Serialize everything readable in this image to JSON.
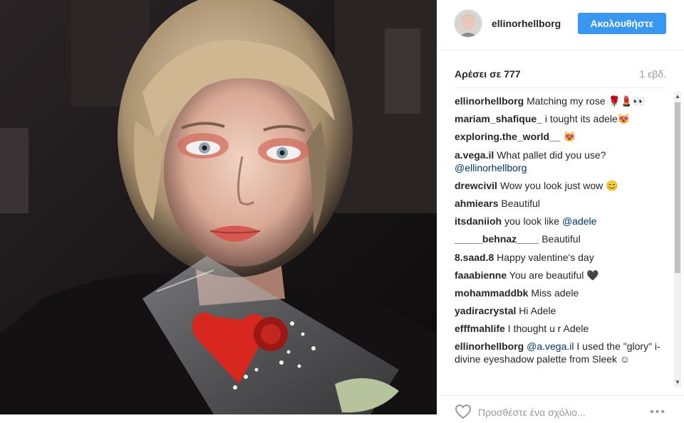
{
  "post": {
    "image_alt": "selfie with rose"
  },
  "header": {
    "username": "ellinorhellborg",
    "follow_label": "Ακολουθήστε"
  },
  "stats": {
    "likes_text": "Αρέσει σε 777",
    "time_ago": "1 εβδ."
  },
  "comments": [
    {
      "user": "ellinorhellborg",
      "parts": [
        {
          "t": "Matching my rose 🌹💄👀"
        }
      ]
    },
    {
      "user": "mariam_shafique_",
      "parts": [
        {
          "t": "i tought its adele😻"
        }
      ]
    },
    {
      "user": "exploring.the_world__",
      "parts": [
        {
          "t": "😻"
        }
      ]
    },
    {
      "user": "a.vega.il",
      "parts": [
        {
          "t": "What pallet did you use? "
        },
        {
          "t": "@ellinorhellborg",
          "mention": true
        }
      ]
    },
    {
      "user": "drewcivil",
      "parts": [
        {
          "t": "Wow you look just wow 😊"
        }
      ]
    },
    {
      "user": "ahmiears",
      "parts": [
        {
          "t": "Beautiful"
        }
      ]
    },
    {
      "user": "itsdaniioh",
      "parts": [
        {
          "t": "you look like "
        },
        {
          "t": "@adele",
          "mention": true
        }
      ]
    },
    {
      "user": "_____behnaz____",
      "parts": [
        {
          "t": "Beautiful"
        }
      ]
    },
    {
      "user": "8.saad.8",
      "parts": [
        {
          "t": "Happy valentine's day"
        }
      ]
    },
    {
      "user": "faaabienne",
      "parts": [
        {
          "t": "You are beautiful 🖤"
        }
      ]
    },
    {
      "user": "mohammaddbk",
      "parts": [
        {
          "t": "Miss adele"
        }
      ]
    },
    {
      "user": "yadiracrystal",
      "parts": [
        {
          "t": "Hi Adele"
        }
      ]
    },
    {
      "user": "efffmahlife",
      "parts": [
        {
          "t": "I thought u r Adele"
        }
      ]
    },
    {
      "user": "ellinorhellborg",
      "parts": [
        {
          "t": " "
        },
        {
          "t": "@a.vega.il",
          "mention": true
        },
        {
          "t": " I used the \"glory\" i-divine eyeshadow palette from Sleek ☺"
        }
      ]
    }
  ],
  "footer": {
    "add_comment_placeholder": "Προσθέστε ένα σχόλιο...",
    "more_label": "•••"
  },
  "colors": {
    "follow_button": "#3897f0",
    "mention": "#003569",
    "muted": "#999999"
  },
  "icons": {
    "like": "heart-outline-icon",
    "more": "more-options-icon"
  }
}
